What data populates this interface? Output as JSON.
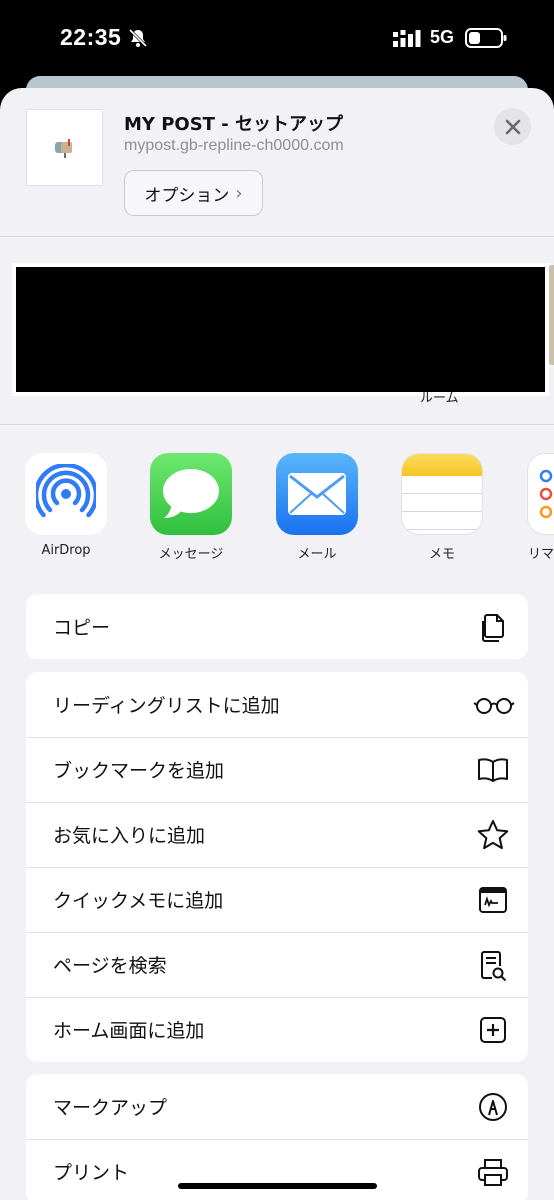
{
  "status": {
    "time": "22:35",
    "network": "5G"
  },
  "share": {
    "title": "MY POST - セットアップ",
    "url": "mypost.gb-repline-ch0000.com",
    "options_label": "オプション",
    "chevron": "›",
    "people_caption": "ルーム"
  },
  "apps": [
    {
      "label": "AirDrop",
      "icon": "airdrop-icon"
    },
    {
      "label": "メッセージ",
      "icon": "messages-icon"
    },
    {
      "label": "メール",
      "icon": "mail-icon"
    },
    {
      "label": "メモ",
      "icon": "notes-icon"
    },
    {
      "label": "リマ",
      "icon": "reminders-icon"
    }
  ],
  "actions": {
    "copy": "コピー",
    "reading_list": "リーディングリストに追加",
    "bookmark": "ブックマークを追加",
    "favorites": "お気に入りに追加",
    "quick_note": "クイックメモに追加",
    "find_on_page": "ページを検索",
    "add_home": "ホーム画面に追加",
    "markup": "マークアップ",
    "print": "プリント"
  },
  "colors": {
    "airdrop_blue": "#2f7cf6",
    "messages_green": "#4cd964",
    "mail_blue": "#2f8cf6",
    "notes_yellow": "#fcd33d"
  }
}
